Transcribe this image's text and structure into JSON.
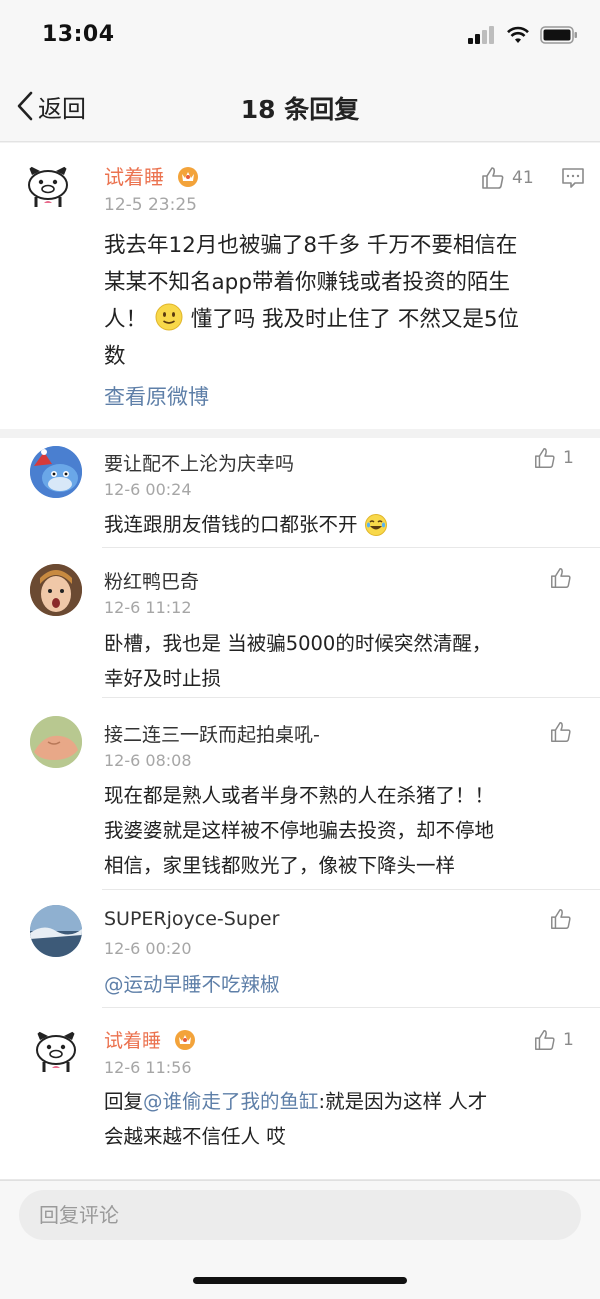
{
  "status_bar": {
    "time": "13:04"
  },
  "nav": {
    "back_label": "返回",
    "title": "18 条回复"
  },
  "main_comment": {
    "user": "试着睡",
    "time": "12-5 23:25",
    "likes": "41",
    "text_line1": "我去年12月也被骗了8千多 千万不要相信在",
    "text_line2": "某某不知名app带着你赚钱或者投资的陌生",
    "text_line3a": "人！",
    "text_line3b": "懂了吗 我及时止住了 不然又是5位",
    "text_line4": "数",
    "view_original": "查看原微博"
  },
  "replies": [
    {
      "user": "要让配不上沦为庆幸吗",
      "time": "12-6 00:24",
      "likes": "1",
      "text": "我连跟朋友借钱的口都张不开"
    },
    {
      "user": "粉红鸭巴奇",
      "time": "12-6 11:12",
      "likes": "",
      "line1": "卧槽，我也是  当被骗5000的时候突然清醒，",
      "line2": "幸好及时止损"
    },
    {
      "user": "接二连三一跃而起拍桌吼-",
      "time": "12-6 08:08",
      "likes": "",
      "line1": "现在都是熟人或者半身不熟的人在杀猪了！！",
      "line2": "我婆婆就是这样被不停地骗去投资，却不停地",
      "line3": "相信，家里钱都败光了，像被下降头一样"
    },
    {
      "user": "SUPERjoyce-Super",
      "time": "12-6 00:20",
      "likes": "",
      "mention": "@运动早睡不吃辣椒"
    },
    {
      "user": "试着睡",
      "time": "12-6 11:56",
      "likes": "1",
      "prefix": "回复",
      "mention": "@谁偷走了我的鱼缸",
      "line1_rest": ":就是因为这样 人才",
      "line2": "会越来越不信任人 哎"
    }
  ],
  "input": {
    "placeholder": "回复评论"
  },
  "colors": {
    "accent_orange": "#eb7350",
    "link_blue": "#5e7fa8",
    "gray_text": "#a6a6a6"
  }
}
